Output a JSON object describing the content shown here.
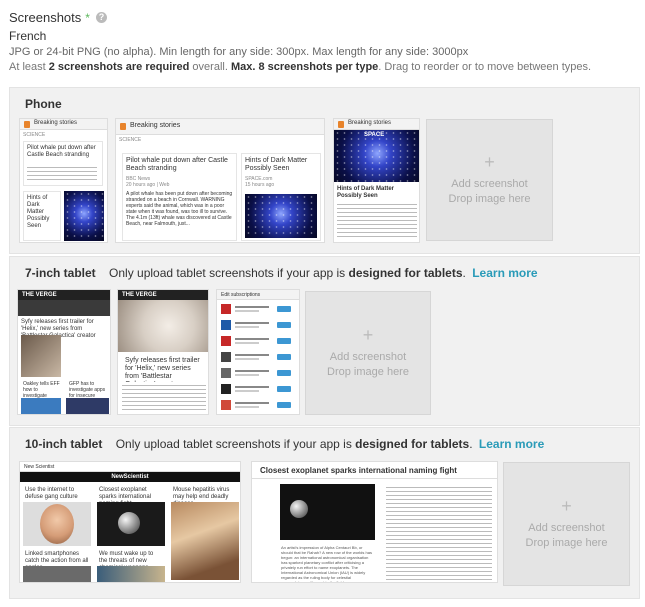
{
  "header": {
    "title": "Screenshots",
    "required_mark": "*",
    "help_icon": "question-icon",
    "language": "French",
    "spec": "JPG or 24-bit PNG (no alpha). Min length for any side: 300px. Max length for any side: 3000px",
    "counts_pre": "At least ",
    "counts_b1": "2 screenshots are required",
    "counts_mid": " overall. ",
    "counts_b2": "Max. 8 screenshots per type",
    "counts_post": ". Drag to reorder or to move between types."
  },
  "sections": {
    "phone": {
      "label": "Phone",
      "add_line1": "Add screenshot",
      "add_line2": "Drop image here",
      "shot1": {
        "bar": "Breaking stories",
        "section": "SCIENCE",
        "card1": "Pilot whale put down after Castle Beach stranding",
        "card2": "Hints of Dark Matter Possibly Seen"
      },
      "shot2": {
        "bar": "Breaking stories",
        "section": "SCIENCE",
        "card1": "Pilot whale put down after Castle Beach stranding",
        "card1_meta": "BBC News",
        "card1_time": "20 hours ago | Web",
        "card1_body": "A pilot whale has been put down after becoming stranded on a beach in Cornwall. WARNING experts said the animal, which was in a poor state when it was found, was too ill to survive. The 4.1m (13ft) whale was discovered at Castle Beach, near Falmouth, just...",
        "card2": "Hints of Dark Matter Possibly Seen",
        "card2_meta": "SPACE.com",
        "card2_time": "15 hours ago"
      },
      "shot3": {
        "bar": "Breaking stories",
        "space_label": "SPACE",
        "caption": "Hints of Dark Matter Possibly Seen"
      }
    },
    "tablet7": {
      "label": "7-inch tablet",
      "desc_pre": "Only upload tablet screenshots if your app is ",
      "desc_bold": "designed for tablets",
      "desc_post": ".",
      "learn": "Learn more",
      "add_line1": "Add screenshot",
      "add_line2": "Drop image here",
      "shot1": {
        "head": "THE VERGE",
        "story1": "Syfy releases first trailer for 'Helix,' new series from 'Battlestar Galactica' creator",
        "story2": "Oakley tells EFF how to investigate",
        "story3": "GFP has to investigate apps for insecure applications, and it's suing them"
      },
      "shot2": {
        "head": "THE VERGE",
        "story": "Syfy releases first trailer for 'Helix,' new series from 'Battlestar Galactica' creator"
      },
      "shot3": {
        "head": "Edit subscriptions"
      }
    },
    "tablet10": {
      "label": "10-inch tablet",
      "desc_pre": "Only upload tablet screenshots if your app is ",
      "desc_bold": "designed for tablets",
      "desc_post": ".",
      "learn": "Learn more",
      "add_line1": "Add screenshot",
      "add_line2": "Drop image here",
      "shot1": {
        "bar": "New Scientist",
        "masthead": "NewScientist",
        "story1": "Use the internet to defuse gang culture",
        "story2": "Closest exoplanet sparks international naming fight",
        "story3": "Mouse hepatitis virus may help end deadly disease",
        "story4": "Linked smartphones catch the action from all angles",
        "story5": "We must wake up to the threats of new chemical weapons"
      },
      "shot2": {
        "headline": "Closest exoplanet sparks international naming fight",
        "body": "An artist's impression of Alpha Centauri Bb, or should that be Rahah? A new row of the worlds has begun: an international astronomical organisation has sparked planetary conflict after criticising a privately run effort to name exoplanets. The International Astronomical Union (IAU) is widely regarded as the ruling body for celestial nomenclature, with most in the field"
      }
    }
  }
}
